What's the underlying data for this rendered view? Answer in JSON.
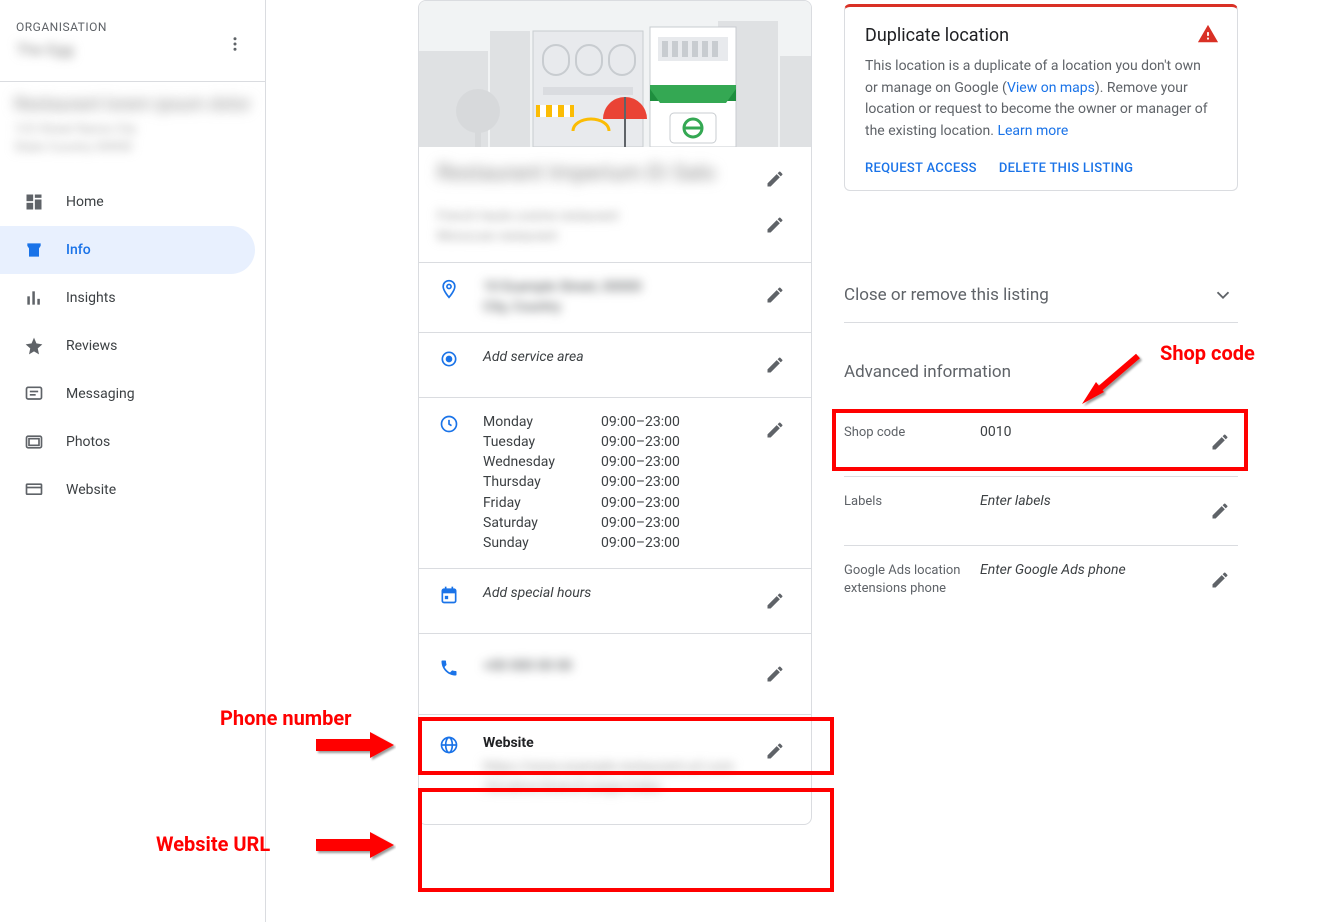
{
  "sidebar": {
    "org_label": "ORGANISATION",
    "nav": [
      {
        "label": "Home"
      },
      {
        "label": "Info"
      },
      {
        "label": "Insights"
      },
      {
        "label": "Reviews"
      },
      {
        "label": "Messaging"
      },
      {
        "label": "Photos"
      },
      {
        "label": "Website"
      }
    ]
  },
  "main": {
    "service_area_placeholder": "Add service area",
    "hours": {
      "Monday": "09:00–23:00",
      "Tuesday": "09:00–23:00",
      "Wednesday": "09:00–23:00",
      "Thursday": "09:00–23:00",
      "Friday": "09:00–23:00",
      "Saturday": "09:00–23:00",
      "Sunday": "09:00–23:00"
    },
    "special_hours_placeholder": "Add special hours",
    "website_label": "Website"
  },
  "alert": {
    "title": "Duplicate location",
    "body_prefix": "This location is a duplicate of a location you don't own or manage on Google (",
    "view_on_maps": "View on maps",
    "body_mid": "). Remove your location or request to become the owner or manager of the existing location. ",
    "learn_more": "Learn more",
    "action_request": "REQUEST ACCESS",
    "action_delete": "DELETE THIS LISTING"
  },
  "close_remove": "Close or remove this listing",
  "advanced": {
    "heading": "Advanced information",
    "shop_code_label": "Shop code",
    "shop_code_value": "0010",
    "labels_label": "Labels",
    "labels_placeholder": "Enter labels",
    "ads_label": "Google Ads location extensions phone",
    "ads_placeholder": "Enter Google Ads phone"
  },
  "annotations": {
    "shop_code": "Shop code",
    "phone": "Phone number",
    "website": "Website URL"
  }
}
